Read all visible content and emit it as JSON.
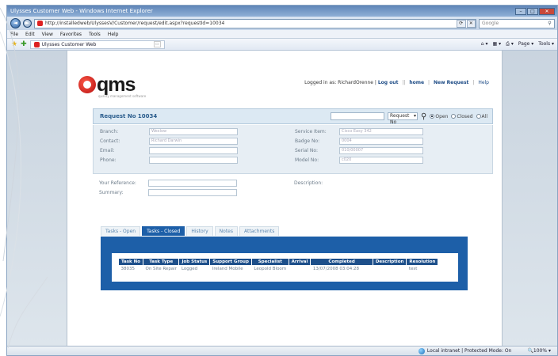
{
  "window": {
    "title": "Ulysses Customer Web - Windows Internet Explorer",
    "minimize": "–",
    "maximize": "□",
    "close": "✕"
  },
  "address_bar": {
    "url": "http://installedweb/UlyssesV/Customer/request/edit.aspx?requestId=10034",
    "search_placeholder": "Google"
  },
  "menu": [
    "File",
    "Edit",
    "View",
    "Favorites",
    "Tools",
    "Help"
  ],
  "favorites_bar": {
    "tab_label": "Ulysses Customer Web",
    "page_label": "Page ▾",
    "tools_label": "Tools ▾"
  },
  "header": {
    "logo_text": "qms",
    "logo_subtext": "quality management software",
    "logged_in_label": "Logged in as: RichardOrenne |",
    "logout": "Log out",
    "home": "home",
    "new_request": "New Request",
    "help": "Help"
  },
  "request": {
    "title": "Request No 10034",
    "search_type": "Request No",
    "radio_open": "Open",
    "radio_closed": "Closed",
    "radio_all": "All"
  },
  "form": {
    "branch_label": "Branch:",
    "branch_value": "Wexlow",
    "contact_label": "Contact:",
    "contact_value": "Richard Darwin",
    "email_label": "Email:",
    "phone_label": "Phone:",
    "service_item_label": "Service Item:",
    "service_item_value": "Cisco Easy 342",
    "badge_label": "Badge No:",
    "badge_value": "0004",
    "serial_label": "Serial No:",
    "serial_value": "010/00007",
    "model_label": "Model No:",
    "model_value": "c020",
    "your_ref_label": "Your Reference:",
    "summary_label": "Summary:",
    "description_label": "Description:"
  },
  "tabs": [
    "Tasks - Open",
    "Tasks - Closed",
    "History",
    "Notes",
    "Attachments"
  ],
  "tasks_table": {
    "columns": [
      "Task No",
      "Task Type",
      "Job Status",
      "Support Group",
      "Specialist",
      "Arrival",
      "Completed",
      "Description",
      "Resolution"
    ],
    "rows": [
      [
        "38035",
        "On Site Repair",
        "Logged",
        "Ireland Mobile",
        "Leopold Bloom",
        "",
        "13/07/2008 03:04:28",
        "",
        "test"
      ]
    ]
  },
  "status_bar": {
    "zone": "Local intranet | Protected Mode: On",
    "zoom": "100%"
  },
  "colors": {
    "tab_active": "#1d5fa8",
    "table_header": "#1d4f8a",
    "logo_red": "#d11a1a"
  }
}
